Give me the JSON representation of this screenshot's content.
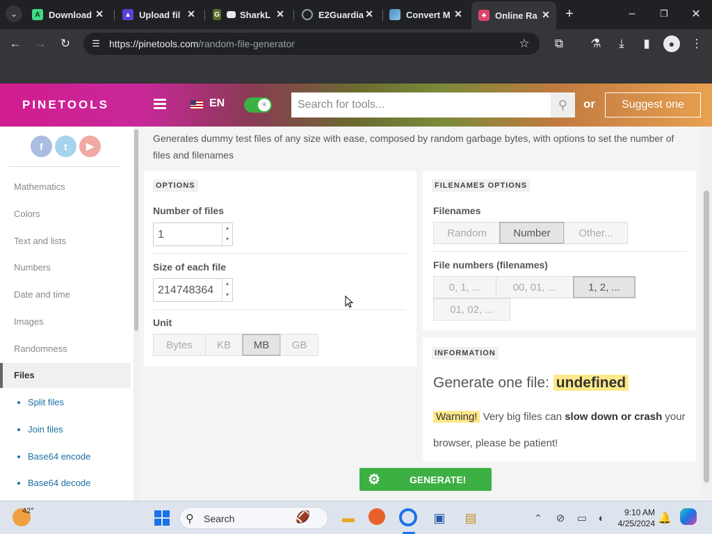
{
  "browser": {
    "tabs": [
      {
        "title": "Download",
        "icon": "android-logo-icon"
      },
      {
        "title": "Upload fil",
        "icon": "upload-icon"
      },
      {
        "title": "SharkL",
        "icon": "sharklasers-icon"
      },
      {
        "title": "E2Guardia",
        "icon": "globe-icon"
      },
      {
        "title": "Convert M",
        "icon": "convert-icon"
      },
      {
        "title": "Online Ra",
        "icon": "pinetools-icon",
        "active": true
      }
    ],
    "url_host": "https://pinetools.com",
    "url_path": "/random-file-generator"
  },
  "site": {
    "logo": "PINETOOLS",
    "lang": "EN",
    "search_placeholder": "Search for tools...",
    "or": "or",
    "suggest": "Suggest one"
  },
  "social": [
    "f",
    "t",
    "▶"
  ],
  "nav": [
    "Mathematics",
    "Colors",
    "Text and lists",
    "Numbers",
    "Date and time",
    "Images",
    "Randomness"
  ],
  "nav_active": "Files",
  "subnav": [
    "Split files",
    "Join files",
    "Base64 encode",
    "Base64 decode"
  ],
  "description": "Generates dummy test files of any size with ease, composed by random garbage bytes, with options to set the number of files and filenames",
  "options": {
    "title": "OPTIONS",
    "num_files_label": "Number of files",
    "num_files_value": "1",
    "size_label": "Size of each file",
    "size_value": "214748364",
    "unit_label": "Unit",
    "units": [
      "Bytes",
      "KB",
      "MB",
      "GB"
    ],
    "unit_selected": "MB"
  },
  "filenames": {
    "title": "FILENAMES OPTIONS",
    "label": "Filenames",
    "modes": [
      "Random",
      "Number",
      "Other..."
    ],
    "mode_selected": "Number",
    "numbers_label": "File numbers (filenames)",
    "numbers": [
      "0, 1, ...",
      "00, 01, ...",
      "1, 2, ...",
      "01, 02, ..."
    ],
    "numbers_selected": "1, 2, ..."
  },
  "information": {
    "title": "INFORMATION",
    "generate_label": "Generate one file:",
    "generate_value": "undefined",
    "warning_tag": "Warning!",
    "warning_text1": "Very big files can",
    "warning_bold": "slow down or crash",
    "warning_text2": "your browser, please be patient!"
  },
  "generate_button": "GENERATE!",
  "taskbar": {
    "weather": "42°",
    "search": "Search",
    "time": "9:10 AM",
    "date": "4/25/2024"
  },
  "colors": {
    "brand_green": "#3cb043",
    "link_blue": "#1a6fa3",
    "highlight": "#ffe88a"
  }
}
